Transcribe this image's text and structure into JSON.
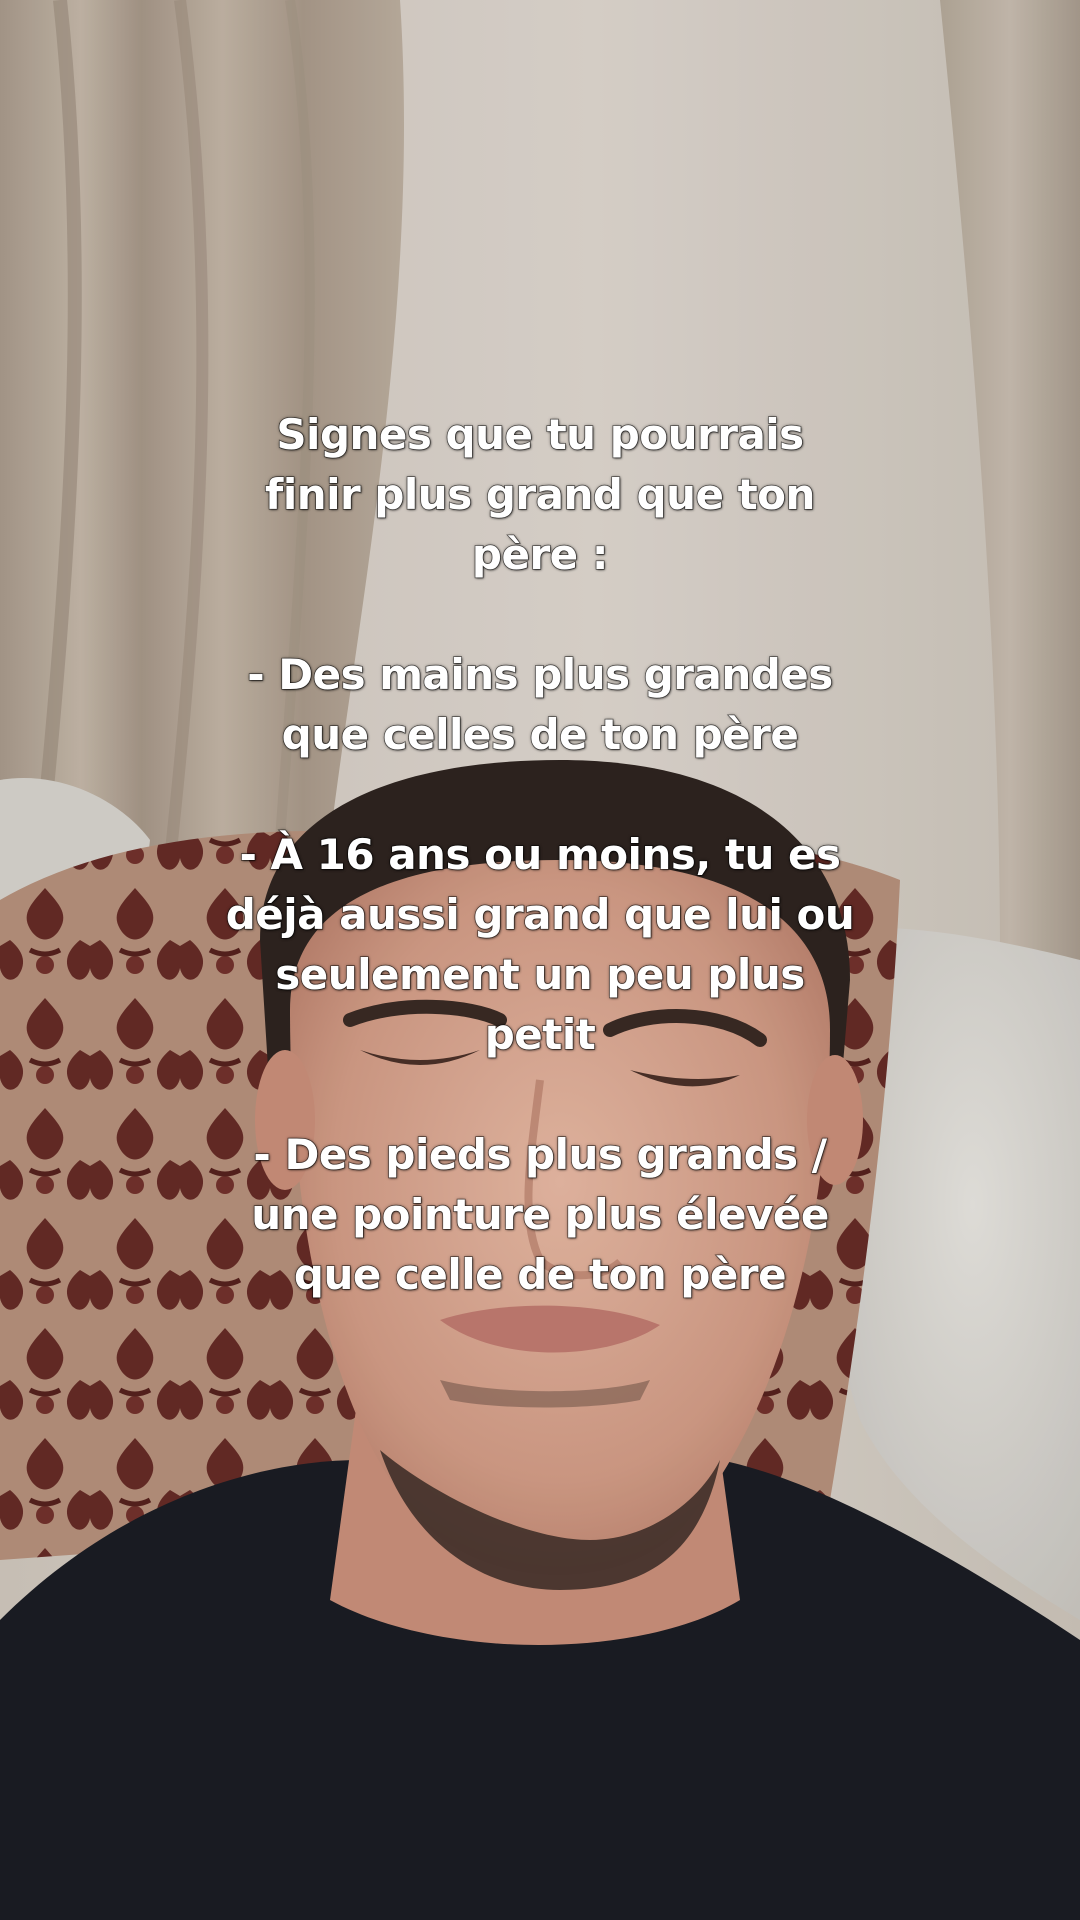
{
  "caption": {
    "lines": [
      "Signes que tu pourrais",
      "finir plus grand que ton",
      "père :",
      "",
      "- Des mains plus grandes",
      "que celles de ton père",
      "",
      "- À 16 ans ou moins, tu es",
      "déjà aussi grand que lui ou",
      "seulement un peu plus",
      "petit",
      "",
      "- Des pieds plus grands /",
      "une pointure plus élevée",
      "que celle de ton père"
    ]
  },
  "colors": {
    "caption_text": "#ffffff",
    "caption_outline": "#000000",
    "wall": "#d6cfc6",
    "curtain": "#b9ab9c",
    "pillow_base": "#c9a48c",
    "pillow_pattern": "#6b2f2a",
    "blanket": "#d9d7d2",
    "skin": "#d9a893",
    "hair": "#2e2420",
    "shirt": "#1b1d24"
  }
}
